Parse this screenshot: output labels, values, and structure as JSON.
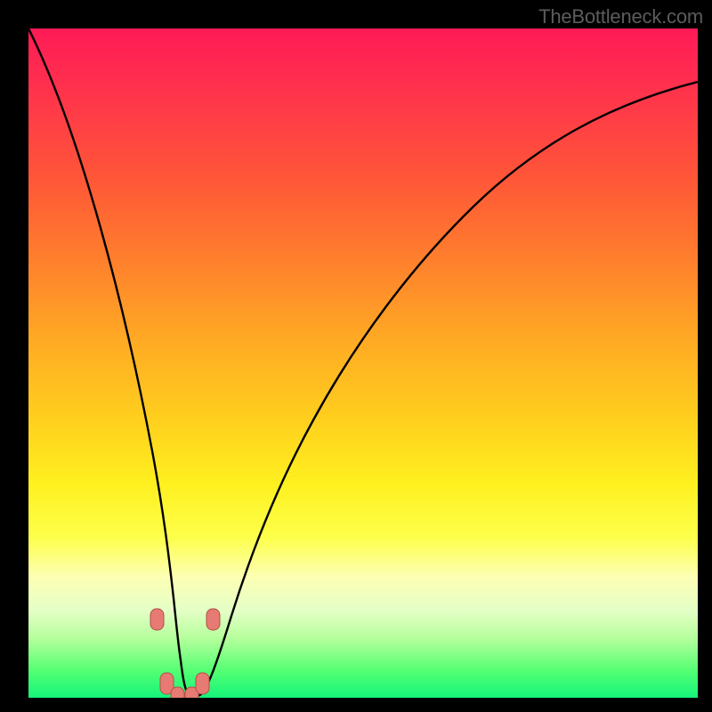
{
  "attribution": "TheBottleneck.com",
  "colors": {
    "background": "#000000",
    "gradient_top": "#ff1a56",
    "gradient_mid1": "#ff7d2d",
    "gradient_mid2": "#fff01f",
    "gradient_bottom": "#14f47a",
    "curve": "#000000",
    "mark_fill": "#e77a72",
    "mark_stroke": "#b25049"
  },
  "chart_data": {
    "type": "line",
    "title": "",
    "xlabel": "",
    "ylabel": "",
    "xlim": [
      0,
      100
    ],
    "ylim": [
      0,
      100
    ],
    "series": [
      {
        "name": "curve",
        "x": [
          0,
          2,
          4,
          6,
          8,
          10,
          12,
          14,
          16,
          18,
          19,
          20,
          21,
          22,
          23,
          24,
          25,
          26,
          28,
          30,
          32,
          35,
          38,
          42,
          46,
          50,
          55,
          60,
          65,
          70,
          75,
          80,
          85,
          90,
          95,
          100
        ],
        "values": [
          100,
          93,
          86,
          79,
          71,
          64,
          56,
          48,
          39,
          28,
          21,
          13,
          4,
          0,
          0,
          0,
          0,
          4,
          16,
          25,
          33,
          42,
          49,
          56,
          62,
          67,
          72,
          76,
          79,
          82,
          84,
          86,
          88,
          89,
          90,
          91
        ]
      }
    ],
    "marks": [
      {
        "x": 18.8,
        "y": 12
      },
      {
        "x": 20.0,
        "y": 3
      },
      {
        "x": 22.0,
        "y": 1
      },
      {
        "x": 24.0,
        "y": 1
      },
      {
        "x": 25.8,
        "y": 3
      },
      {
        "x": 27.0,
        "y": 12
      }
    ]
  }
}
